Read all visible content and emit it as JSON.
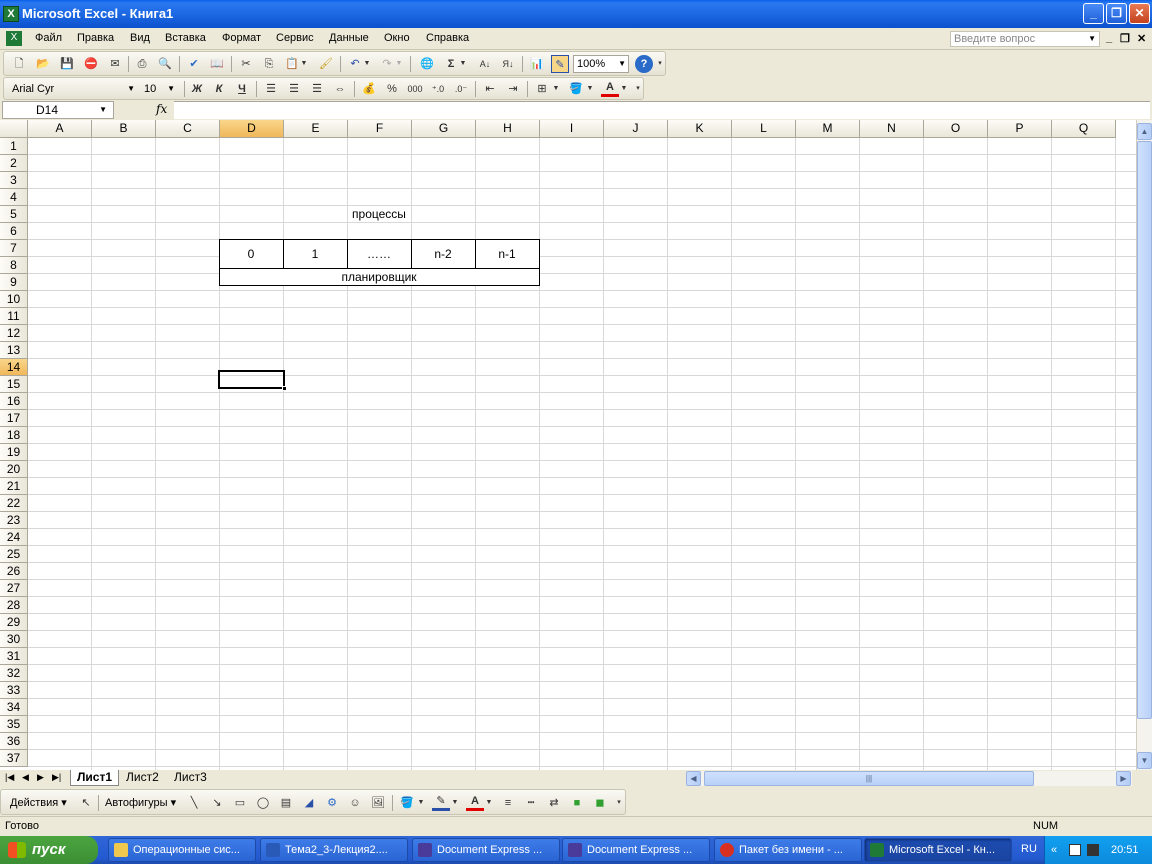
{
  "window": {
    "title": "Microsoft Excel - Книга1"
  },
  "menu": {
    "items": [
      "Файл",
      "Правка",
      "Вид",
      "Вставка",
      "Формат",
      "Сервис",
      "Данные",
      "Окно",
      "Справка"
    ],
    "ask_placeholder": "Введите вопрос"
  },
  "standard_toolbar": {
    "zoom": "100%"
  },
  "format_toolbar": {
    "font": "Arial Cyr",
    "size": "10",
    "bold": "Ж",
    "italic": "К",
    "underline": "Ч",
    "percent": "%",
    "thousands": "000"
  },
  "formula_bar": {
    "name_box": "D14",
    "fx": "fx",
    "value": ""
  },
  "columns": [
    "A",
    "B",
    "C",
    "D",
    "E",
    "F",
    "G",
    "H",
    "I",
    "J",
    "K",
    "L",
    "M",
    "N",
    "O",
    "P",
    "Q"
  ],
  "rows": [
    "1",
    "2",
    "3",
    "4",
    "5",
    "6",
    "7",
    "8",
    "9",
    "10",
    "11",
    "12",
    "13",
    "14",
    "15",
    "16",
    "17",
    "18",
    "19",
    "20",
    "21",
    "22",
    "23",
    "24",
    "25",
    "26",
    "27",
    "28",
    "29",
    "30",
    "31",
    "32",
    "33",
    "34",
    "35",
    "36",
    "37"
  ],
  "selected": {
    "column": "D",
    "row": "14"
  },
  "cells": {
    "F5": "процессы",
    "D7": "0",
    "E7": "1",
    "F7": "……",
    "G7": "n-2",
    "H7": "n-1",
    "F8": "планировщик"
  },
  "sheet_tabs": [
    "Лист1",
    "Лист2",
    "Лист3"
  ],
  "active_sheet": "Лист1",
  "drawing_toolbar": {
    "actions": "Действия",
    "autoshapes": "Автофигуры"
  },
  "status": {
    "left": "Готово",
    "num": "NUM"
  },
  "taskbar": {
    "start": "пуск",
    "tasks": [
      {
        "label": "Операционные сис...",
        "active": false
      },
      {
        "label": "Тема2_3-Лекция2....",
        "active": false
      },
      {
        "label": "Document Express ...",
        "active": false
      },
      {
        "label": "Document Express ...",
        "active": false
      },
      {
        "label": "Пакет без имени - ...",
        "active": false
      },
      {
        "label": "Microsoft Excel - Кн...",
        "active": true
      }
    ],
    "lang": "RU",
    "clock": "20:51"
  },
  "colors": {
    "title_bar": "#0a5fe8",
    "selection_header": "#f0b75a",
    "taskbar": "#245ad0",
    "start_button": "#3c8f34"
  }
}
